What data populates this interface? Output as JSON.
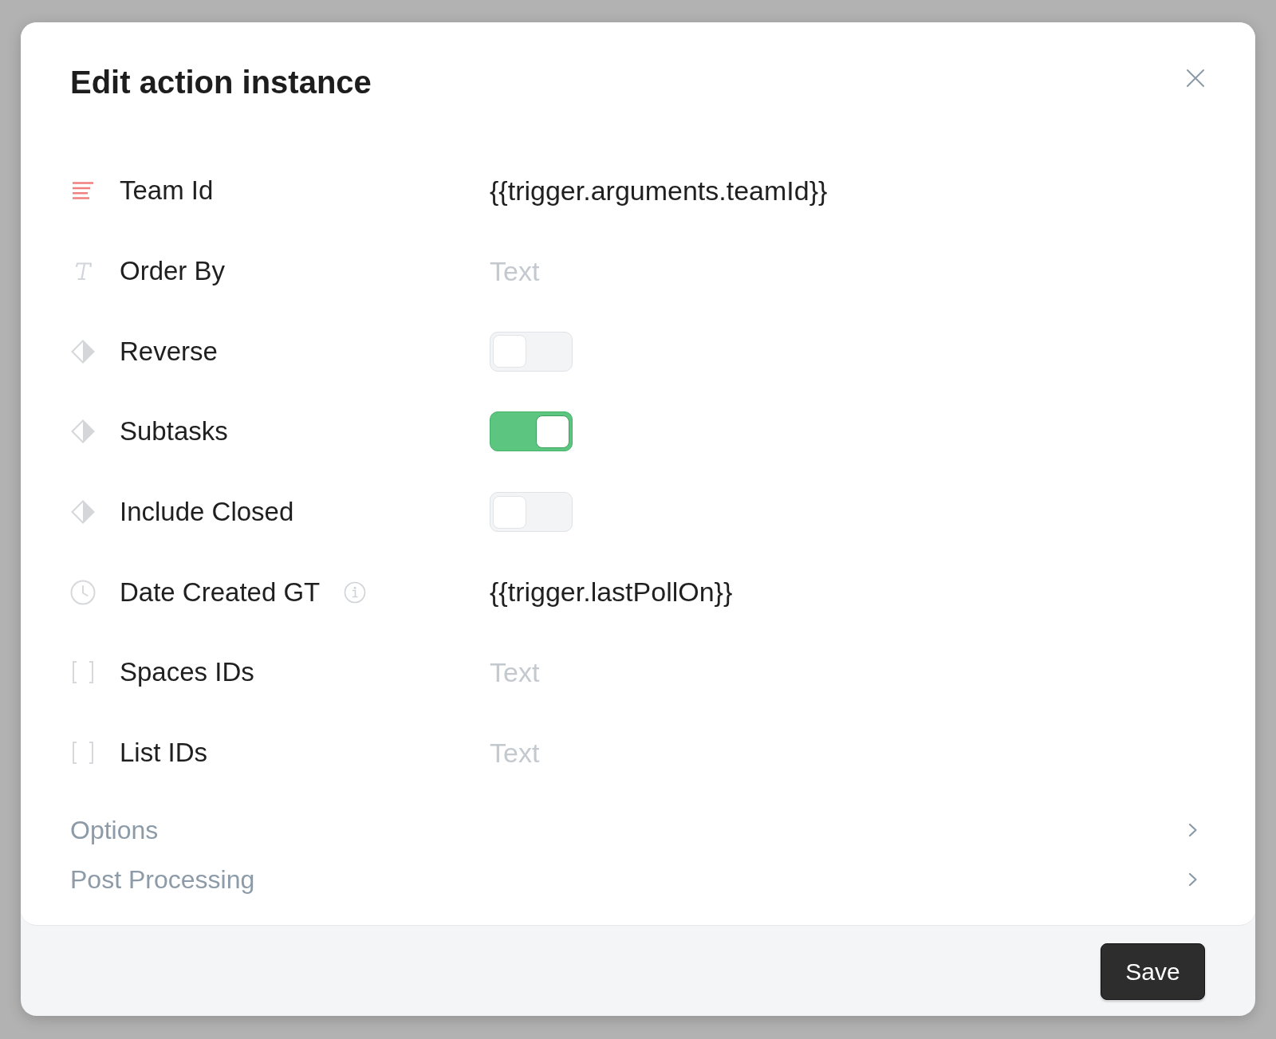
{
  "dialog": {
    "title": "Edit action instance"
  },
  "fields": [
    {
      "kind": "id",
      "label": "Team Id",
      "info": false,
      "value": "{{trigger.arguments.teamId}}"
    },
    {
      "kind": "text",
      "label": "Order By",
      "info": false,
      "placeholder": "Text"
    },
    {
      "kind": "boolean",
      "label": "Reverse",
      "info": false,
      "on": false
    },
    {
      "kind": "boolean",
      "label": "Subtasks",
      "info": false,
      "on": true
    },
    {
      "kind": "boolean",
      "label": "Include Closed",
      "info": false,
      "on": false
    },
    {
      "kind": "date",
      "label": "Date Created GT",
      "info": true,
      "value": "{{trigger.lastPollOn}}"
    },
    {
      "kind": "array",
      "label": "Spaces IDs",
      "info": false,
      "placeholder": "Text"
    },
    {
      "kind": "array",
      "label": "List IDs",
      "info": false,
      "placeholder": "Text"
    }
  ],
  "sections": [
    {
      "label": "Options",
      "expanded": false
    },
    {
      "label": "Post Processing",
      "expanded": false
    }
  ],
  "footer": {
    "save_button": "Save"
  }
}
